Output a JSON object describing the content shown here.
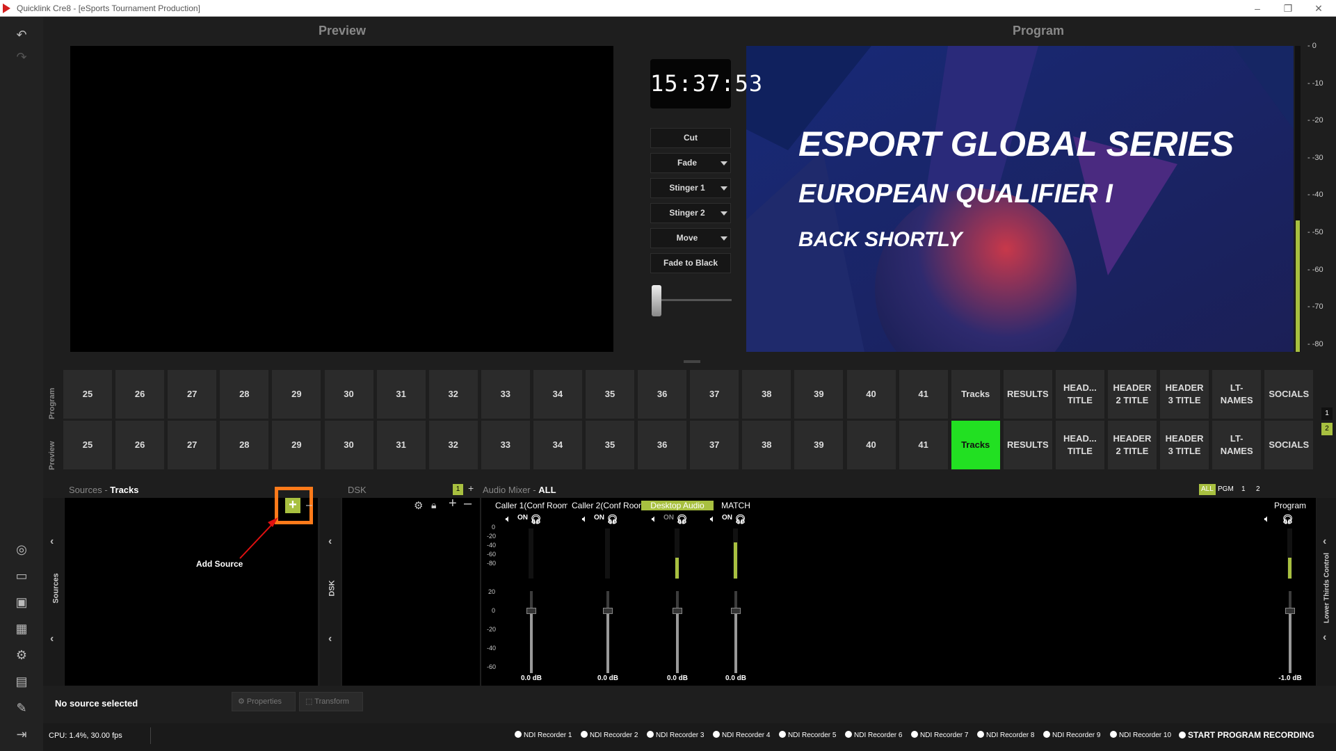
{
  "window": {
    "app": "Quicklink Cre8",
    "document": "[eSports Tournament Production]",
    "title": "Quicklink Cre8 - [eSports Tournament Production]"
  },
  "headers": {
    "preview": "Preview",
    "program": "Program"
  },
  "clock": "15:37:53",
  "transitions": [
    {
      "label": "Cut",
      "dropdown": false
    },
    {
      "label": "Fade",
      "dropdown": true
    },
    {
      "label": "Stinger 1",
      "dropdown": true
    },
    {
      "label": "Stinger 2",
      "dropdown": true
    },
    {
      "label": "Move",
      "dropdown": true
    },
    {
      "label": "Fade to Black",
      "dropdown": false
    }
  ],
  "program_graphic": {
    "line1": "ESPORT GLOBAL SERIES",
    "line2": "EUROPEAN QUALIFIER I",
    "line3": "BACK SHORTLY"
  },
  "program_meter_scale": [
    "0",
    "-10",
    "-20",
    "-30",
    "-40",
    "-50",
    "-60",
    "-70",
    "-80"
  ],
  "program_meter_level_fraction": 0.43,
  "rows": {
    "program_label": "Program",
    "preview_label": "Preview"
  },
  "scenes": [
    "25",
    "26",
    "27",
    "28",
    "29",
    "30",
    "31",
    "32",
    "33",
    "34",
    "35",
    "36",
    "37",
    "38",
    "39",
    "40",
    "41",
    "Tracks",
    "RESULTS",
    "HEAD...\nTITLE",
    "HEADER\n2 TITLE",
    "HEADER\n3 TITLE",
    "LT-\nNAMES",
    "SOCIALS"
  ],
  "preview_active_scene": "Tracks",
  "page_tabs": [
    "1",
    "2"
  ],
  "sources": {
    "label": "Sources",
    "sep": "-",
    "scene": "Tracks",
    "side_label": "Sources",
    "annotation": "Add Source",
    "add_icon": "plus-icon",
    "remove_icon": "minus-icon"
  },
  "dsk": {
    "label": "DSK",
    "side_label": "DSK",
    "badge": "1",
    "plus": "+"
  },
  "audio": {
    "label": "Audio Mixer",
    "sep": "-",
    "filter": "ALL",
    "tabs": [
      "ALL",
      "PGM",
      "1",
      "2"
    ],
    "scale_top": [
      "0",
      "-20",
      "-40",
      "-60",
      "-80"
    ],
    "scale_bottom": [
      "20",
      "0",
      "-20",
      "-40",
      "-60"
    ],
    "on_label": "ON",
    "channels": [
      {
        "name": "Caller 1(Conf Room",
        "db": "0.0 dB",
        "highlight": false,
        "level": 0,
        "on_dim": false
      },
      {
        "name": "Caller 2(Conf Room",
        "db": "0.0 dB",
        "highlight": false,
        "level": 0,
        "on_dim": false
      },
      {
        "name": "Desktop Audio",
        "db": "0.0 dB",
        "highlight": true,
        "level": 0.42,
        "on_dim": true
      },
      {
        "name": "MATCH",
        "db": "0.0 dB",
        "highlight": false,
        "level": 0.72,
        "on_dim": false
      }
    ],
    "program": {
      "name": "Program",
      "db": "-1.0 dB",
      "level": 0.42
    }
  },
  "right_panel_label": "Lower Thirds Control",
  "status": {
    "source": "No source selected",
    "properties": "Properties",
    "transform": "Transform",
    "cpu": "CPU: 1.4%, 30.00 fps"
  },
  "recorders": [
    "NDI Recorder 1",
    "NDI Recorder 2",
    "NDI Recorder 3",
    "NDI Recorder 4",
    "NDI Recorder 5",
    "NDI Recorder 6",
    "NDI Recorder 7",
    "NDI Recorder 8",
    "NDI Recorder 9",
    "NDI Recorder 10"
  ],
  "start_recording": "START PROGRAM RECORDING",
  "colors": {
    "accent": "#a8c040",
    "active_scene": "#22e022",
    "annotation": "#ff7a1a",
    "arrow": "#e01010"
  }
}
